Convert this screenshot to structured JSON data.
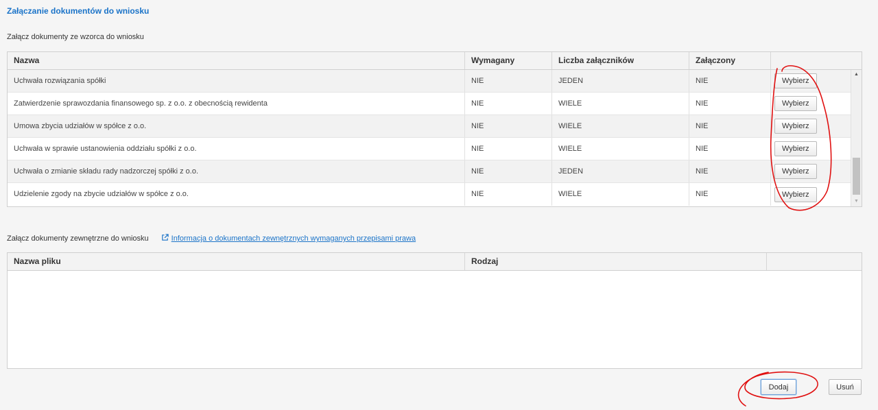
{
  "page": {
    "title": "Załączanie dokumentów do wniosku"
  },
  "template_section": {
    "label": "Załącz dokumenty ze wzorca do wniosku",
    "columns": [
      "Nazwa",
      "Wymagany",
      "Liczba załączników",
      "Załączony",
      ""
    ],
    "rows": [
      {
        "name": "Uchwała rozwiązania spółki",
        "required": "NIE",
        "count": "JEDEN",
        "attached": "NIE",
        "action": "Wybierz"
      },
      {
        "name": "Zatwierdzenie sprawozdania finansowego sp. z o.o. z obecnością rewidenta",
        "required": "NIE",
        "count": "WIELE",
        "attached": "NIE",
        "action": "Wybierz"
      },
      {
        "name": "Umowa zbycia udziałów w spółce z o.o.",
        "required": "NIE",
        "count": "WIELE",
        "attached": "NIE",
        "action": "Wybierz"
      },
      {
        "name": "Uchwała w sprawie ustanowienia oddziału spółki z o.o.",
        "required": "NIE",
        "count": "WIELE",
        "attached": "NIE",
        "action": "Wybierz"
      },
      {
        "name": "Uchwała o zmianie składu rady nadzorczej spółki z o.o.",
        "required": "NIE",
        "count": "JEDEN",
        "attached": "NIE",
        "action": "Wybierz"
      },
      {
        "name": "Udzielenie zgody na zbycie udziałów w spółce z o.o.",
        "required": "NIE",
        "count": "WIELE",
        "attached": "NIE",
        "action": "Wybierz"
      }
    ]
  },
  "external_section": {
    "label": "Załącz dokumenty zewnętrzne do wniosku",
    "link_icon": "external-link-icon",
    "link_text": "Informacja o dokumentach zewnętrznych wymaganych przepisami prawa",
    "columns": [
      "Nazwa pliku",
      "Rodzaj",
      ""
    ],
    "rows": []
  },
  "actions": {
    "add_label": "Dodaj",
    "remove_label": "Usuń"
  },
  "colors": {
    "accent": "#1a73c8",
    "annotation": "#e01010"
  }
}
